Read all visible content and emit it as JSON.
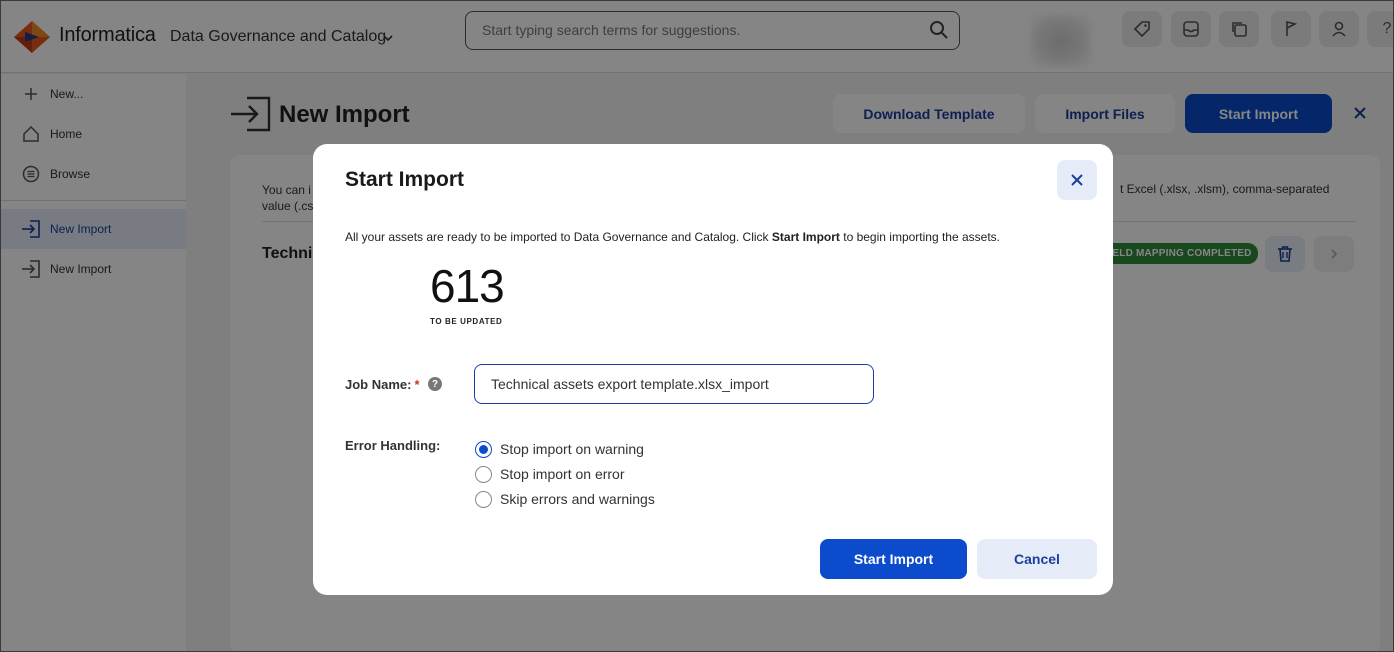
{
  "header": {
    "brand": "Informatica",
    "product": "Data Governance and Catalog",
    "search_placeholder": "Start typing search terms for suggestions."
  },
  "sidebar": {
    "items": [
      {
        "label": "New...",
        "icon": "plus-icon"
      },
      {
        "label": "Home",
        "icon": "home-icon"
      },
      {
        "label": "Browse",
        "icon": "browse-icon"
      },
      {
        "label": "New Import",
        "icon": "import-icon",
        "active": true
      },
      {
        "label": "New Import",
        "icon": "import-icon"
      }
    ]
  },
  "page": {
    "title": "New Import",
    "download_template": "Download Template",
    "import_files": "Import Files",
    "start_import": "Start Import",
    "description_left": "You can i",
    "description_left_2": "value (.cs",
    "description_right": "t Excel (.xlsx, .xlsm), comma-separated",
    "row_title": "Technic",
    "status_badge": "IELD MAPPING COMPLETED"
  },
  "modal": {
    "title": "Start Import",
    "desc_prefix": "All your assets are ready to be imported to Data Governance and Catalog. Click ",
    "desc_bold": "Start Import",
    "desc_suffix": " to begin importing the assets.",
    "count": "613",
    "count_label": "TO BE UPDATED",
    "job_name_label": "Job Name:",
    "job_name_required": "*",
    "job_name_value": "Technical assets export template.xlsx_import",
    "error_handling_label": "Error Handling:",
    "error_options": [
      {
        "label": "Stop import on warning",
        "selected": true
      },
      {
        "label": "Stop import on error",
        "selected": false
      },
      {
        "label": "Skip errors and warnings",
        "selected": false
      }
    ],
    "start_button": "Start Import",
    "cancel_button": "Cancel"
  },
  "colors": {
    "primary": "#0b4bcc",
    "accent_text": "#1a3f9c",
    "badge_green": "#2f8a3b"
  }
}
